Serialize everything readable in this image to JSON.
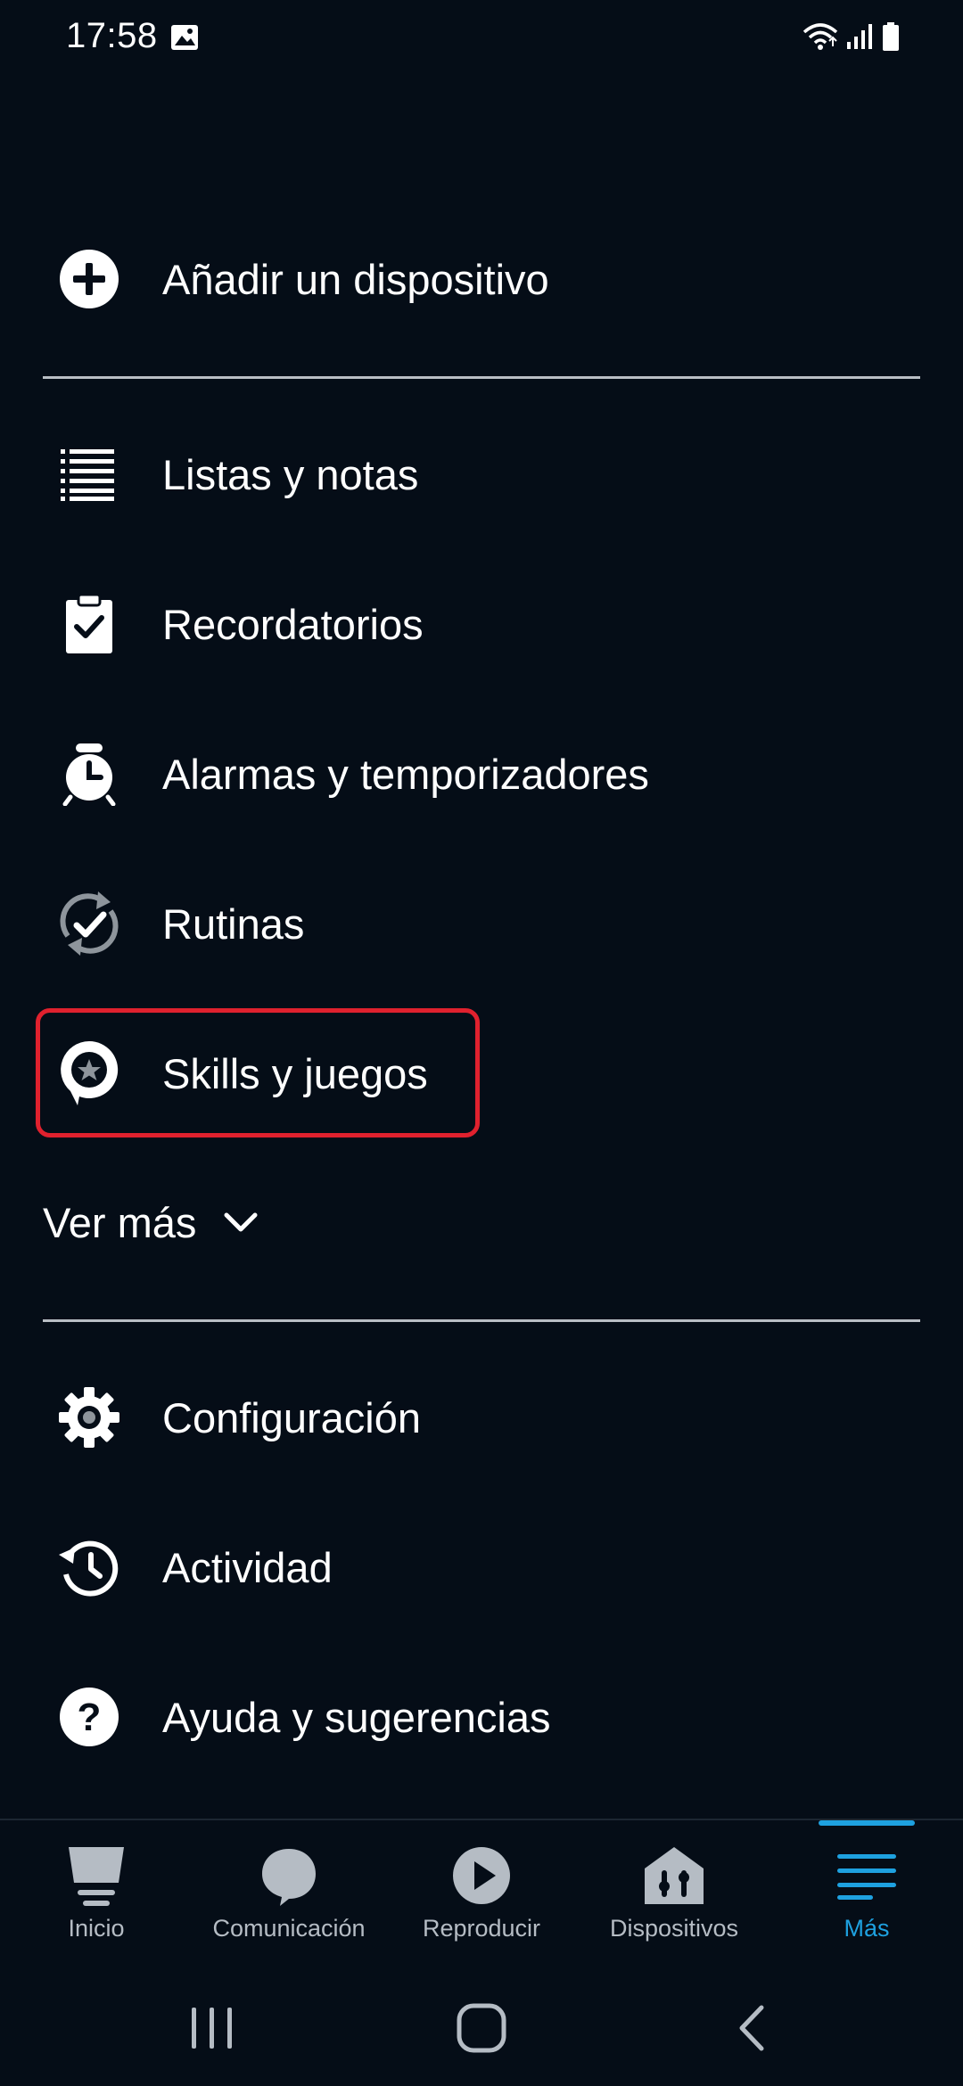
{
  "status_bar": {
    "time": "17:58"
  },
  "menu": {
    "add_device": {
      "label": "Añadir un dispositivo",
      "icon": "plus-circle-icon"
    },
    "items": [
      {
        "label": "Listas y notas",
        "icon": "list-icon"
      },
      {
        "label": "Recordatorios",
        "icon": "clipboard-check-icon"
      },
      {
        "label": "Alarmas y temporizadores",
        "icon": "alarm-clock-icon"
      },
      {
        "label": "Rutinas",
        "icon": "routine-check-icon"
      },
      {
        "label": "Skills y juegos",
        "icon": "skill-star-bubble-icon",
        "highlighted": true
      }
    ],
    "see_more": "Ver más",
    "settings_items": [
      {
        "label": "Configuración",
        "icon": "gear-icon"
      },
      {
        "label": "Actividad",
        "icon": "history-icon"
      },
      {
        "label": "Ayuda y sugerencias",
        "icon": "help-icon"
      }
    ]
  },
  "bottom_nav": {
    "items": [
      {
        "label": "Inicio",
        "icon": "home-icon",
        "active": false
      },
      {
        "label": "Comunicación",
        "icon": "chat-bubble-icon",
        "active": false
      },
      {
        "label": "Reproducir",
        "icon": "play-icon",
        "active": false
      },
      {
        "label": "Dispositivos",
        "icon": "devices-house-icon",
        "active": false
      },
      {
        "label": "Más",
        "icon": "menu-lines-icon",
        "active": true
      }
    ],
    "active_color": "#1ea1e0",
    "inactive_color": "#b5bcc4"
  },
  "colors": {
    "background": "#050d17",
    "highlight_border": "#e0212e",
    "divider": "#b9bec4"
  }
}
